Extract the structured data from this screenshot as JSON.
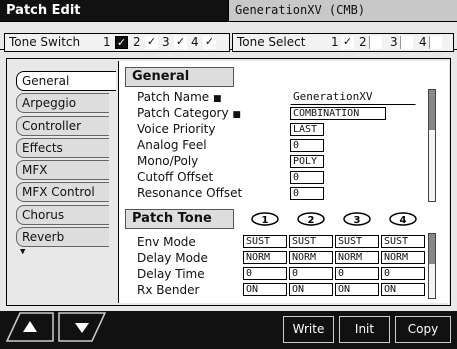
{
  "header": {
    "title": "Patch Edit",
    "patch_name": "GenerationXV  (CMB)"
  },
  "tone_switch": {
    "label": "Tone Switch",
    "tones": [
      {
        "num": "1",
        "on": true
      },
      {
        "num": "2",
        "on": true
      },
      {
        "num": "3",
        "on": true
      },
      {
        "num": "4",
        "on": true
      }
    ]
  },
  "tone_select": {
    "label": "Tone Select",
    "tones": [
      {
        "num": "1",
        "on": true
      },
      {
        "num": "2",
        "on": false
      },
      {
        "num": "3",
        "on": false
      },
      {
        "num": "4",
        "on": false
      }
    ]
  },
  "sidebar": {
    "items": [
      {
        "label": "General",
        "active": true
      },
      {
        "label": "Arpeggio"
      },
      {
        "label": "Controller"
      },
      {
        "label": "Effects"
      },
      {
        "label": "MFX"
      },
      {
        "label": "MFX Control"
      },
      {
        "label": "Chorus"
      },
      {
        "label": "Reverb"
      }
    ],
    "more_indicator": "▼"
  },
  "general": {
    "title": "General",
    "params": [
      {
        "label": "Patch Name",
        "value": "GenerationXV"
      },
      {
        "label": "Patch Category",
        "value": "COMBINATION"
      },
      {
        "label": "Voice Priority",
        "value": "LAST"
      },
      {
        "label": "Analog Feel",
        "value": "0"
      },
      {
        "label": "Mono/Poly",
        "value": "POLY"
      },
      {
        "label": "Cutoff Offset",
        "value": "0"
      },
      {
        "label": "Resonance Offset",
        "value": "0"
      }
    ]
  },
  "patch_tone": {
    "title": "Patch Tone",
    "tone_numbers": [
      "1",
      "2",
      "3",
      "4"
    ],
    "rows": [
      {
        "label": "Env Mode",
        "values": [
          "SUST",
          "SUST",
          "SUST",
          "SUST"
        ]
      },
      {
        "label": "Delay Mode",
        "values": [
          "NORM",
          "NORM",
          "NORM",
          "NORM"
        ]
      },
      {
        "label": "Delay Time",
        "values": [
          "0",
          "0",
          "0",
          "0"
        ]
      },
      {
        "label": "Rx Bender",
        "values": [
          "ON",
          "ON",
          "ON",
          "ON"
        ]
      }
    ]
  },
  "footer": {
    "write": "Write",
    "init": "Init",
    "copy": "Copy"
  }
}
